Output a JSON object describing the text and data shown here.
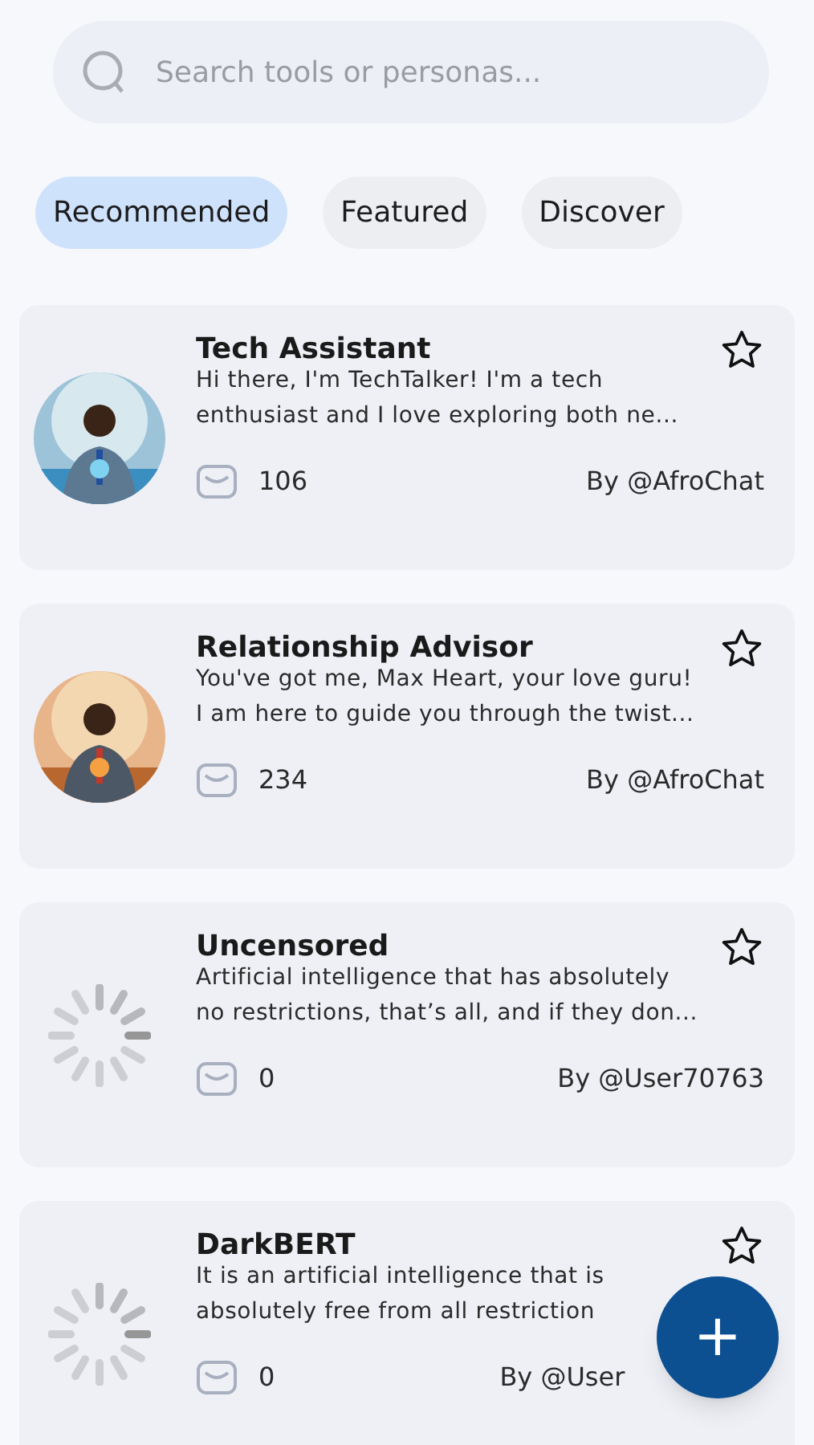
{
  "search": {
    "placeholder": "Search tools or personas..."
  },
  "tabs": [
    {
      "label": "Recommended",
      "selected": true
    },
    {
      "label": "Featured",
      "selected": false
    },
    {
      "label": "Discover",
      "selected": false
    }
  ],
  "personas": [
    {
      "title": "Tech Assistant",
      "description": "Hi there, I'm TechTalker! I'm a tech\nenthusiast and I love exploring both ne...",
      "messages": "106",
      "author": "By @AfroChat",
      "kind": "picture",
      "starred": false
    },
    {
      "title": "Relationship Advisor",
      "description": "You've got me, Max Heart, your love guru!\nI am here to guide you through the twist...",
      "messages": "234",
      "author": "By @AfroChat",
      "kind": "picture",
      "starred": false
    },
    {
      "title": "Uncensored",
      "description": "Artificial intelligence that has absolutely\nno restrictions, that’s all, and if they don...",
      "messages": "0",
      "author": "By @User70763",
      "kind": "loading",
      "starred": false
    },
    {
      "title": "DarkBERT",
      "description": "It is an artificial intelligence that is\nabsolutely free from all restriction",
      "messages": "0",
      "author": "By @User",
      "kind": "loading",
      "starred": false
    }
  ],
  "fab": {
    "label": "+"
  }
}
